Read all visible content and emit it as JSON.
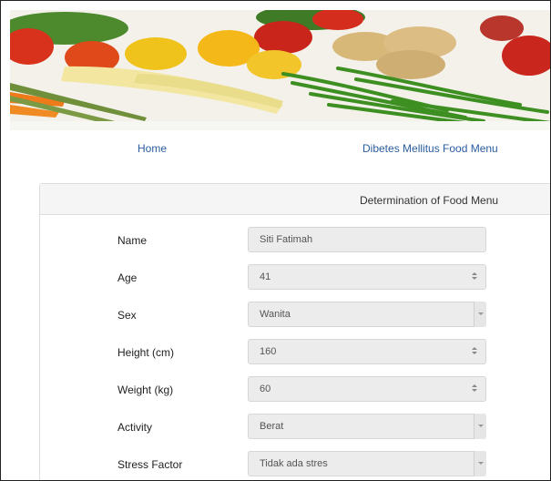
{
  "nav": {
    "home_label": "Home",
    "menu_label": "Dibetes Mellitus Food Menu"
  },
  "panel": {
    "title": "Determination of Food Menu"
  },
  "form": {
    "name": {
      "label": "Name",
      "value": "Siti Fatimah"
    },
    "age": {
      "label": "Age",
      "value": "41"
    },
    "sex": {
      "label": "Sex",
      "value": "Wanita"
    },
    "height": {
      "label": "Height (cm)",
      "value": "160"
    },
    "weight": {
      "label": "Weight (kg)",
      "value": "60"
    },
    "activity": {
      "label": "Activity",
      "value": "Berat"
    },
    "stress": {
      "label": "Stress Factor",
      "value": "Tidak ada stres"
    }
  },
  "colors": {
    "link": "#2a5d9f",
    "field_bg": "#ececec",
    "panel_head_bg": "#f5f5f5"
  }
}
